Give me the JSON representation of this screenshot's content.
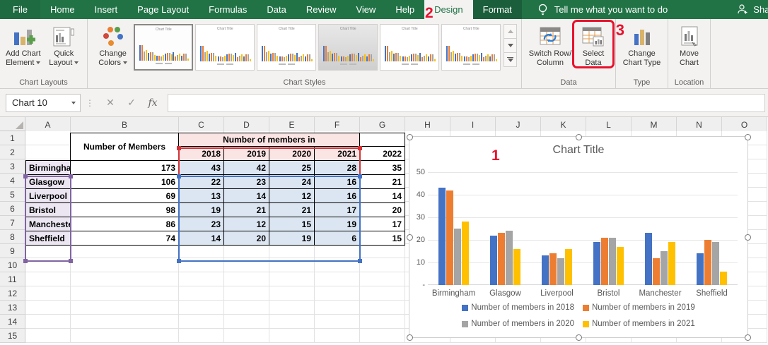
{
  "menu": {
    "tabs": [
      "File",
      "Home",
      "Insert",
      "Page Layout",
      "Formulas",
      "Data",
      "Review",
      "View",
      "Help",
      "Design",
      "Format"
    ],
    "active_tab": "Design",
    "contextual_tab": "Format",
    "tell_me": "Tell me what you want to do",
    "share": "Share"
  },
  "ribbon": {
    "add_chart_element": {
      "line1": "Add Chart",
      "line2": "Element"
    },
    "quick_layout": {
      "line1": "Quick",
      "line2": "Layout"
    },
    "change_colors": {
      "line1": "Change",
      "line2": "Colors"
    },
    "switch_row_column": {
      "line1": "Switch Row/",
      "line2": "Column"
    },
    "select_data": {
      "line1": "Select",
      "line2": "Data"
    },
    "change_chart_type": {
      "line1": "Change",
      "line2": "Chart Type"
    },
    "move_chart": {
      "line1": "Move",
      "line2": "Chart"
    },
    "groups": {
      "chart_layouts": "Chart Layouts",
      "chart_styles": "Chart Styles",
      "data": "Data",
      "type": "Type",
      "location": "Location"
    },
    "style_thumb_title": "Chart Title"
  },
  "formula_bar": {
    "name_box": "Chart 10",
    "fx": "fx",
    "formula": ""
  },
  "annotations": {
    "step1": "1",
    "step2": "2",
    "step3": "3"
  },
  "sheet": {
    "col_headers": [
      "A",
      "B",
      "C",
      "D",
      "E",
      "F",
      "G",
      "H",
      "I",
      "J",
      "K",
      "L",
      "M",
      "N",
      "O"
    ],
    "row_count": 15,
    "table": {
      "members_header": "Number of Members",
      "group_header": "Number of members in",
      "year_headers": [
        "2018",
        "2019",
        "2020",
        "2021"
      ],
      "extra_year_header": "2022",
      "rows": [
        {
          "city": "Birmingham",
          "total": 173,
          "values": [
            43,
            42,
            25,
            28
          ],
          "extra": 35
        },
        {
          "city": "Glasgow",
          "total": 106,
          "values": [
            22,
            23,
            24,
            16
          ],
          "extra": 21
        },
        {
          "city": "Liverpool",
          "total": 69,
          "values": [
            13,
            14,
            12,
            16
          ],
          "extra": 14
        },
        {
          "city": "Bristol",
          "total": 98,
          "values": [
            19,
            21,
            21,
            17
          ],
          "extra": 20
        },
        {
          "city": "Manchester",
          "total": 86,
          "values": [
            23,
            12,
            15,
            19
          ],
          "extra": 17
        },
        {
          "city": "Sheffield",
          "total": 74,
          "values": [
            14,
            20,
            19,
            6
          ],
          "extra": 15
        }
      ]
    }
  },
  "chart_data": {
    "type": "bar",
    "title": "Chart Title",
    "categories": [
      "Birmingham",
      "Glasgow",
      "Liverpool",
      "Bristol",
      "Manchester",
      "Sheffield"
    ],
    "series": [
      {
        "name": "Number of members in 2018",
        "color": "#4472C4",
        "values": [
          43,
          22,
          13,
          19,
          23,
          14
        ]
      },
      {
        "name": "Number of members in 2019",
        "color": "#ED7D31",
        "values": [
          42,
          23,
          14,
          21,
          12,
          20
        ]
      },
      {
        "name": "Number of members in 2020",
        "color": "#A5A5A5",
        "values": [
          25,
          24,
          12,
          21,
          15,
          19
        ]
      },
      {
        "name": "Number of members in 2021",
        "color": "#FFC000",
        "values": [
          28,
          16,
          16,
          17,
          19,
          6
        ]
      }
    ],
    "ylim": [
      0,
      50
    ],
    "yticks": [
      50,
      40,
      30,
      20,
      10
    ],
    "zero_label": "-",
    "grid": true,
    "legend_position": "bottom"
  },
  "colors": {
    "excel_green": "#217346",
    "annotation_red": "#E8112D",
    "range_red": "#D13438",
    "range_purple": "#8064A2",
    "range_blue": "#4472C4",
    "header_pink": "#FBE5E4",
    "city_lavender": "#ECE6F2",
    "selection_blue_fill": "#DCE6F2"
  },
  "icons": {
    "name_box_dropdown": "▾",
    "cancel": "✕",
    "accept": "✓",
    "formula_separator_dots": "⋮"
  }
}
